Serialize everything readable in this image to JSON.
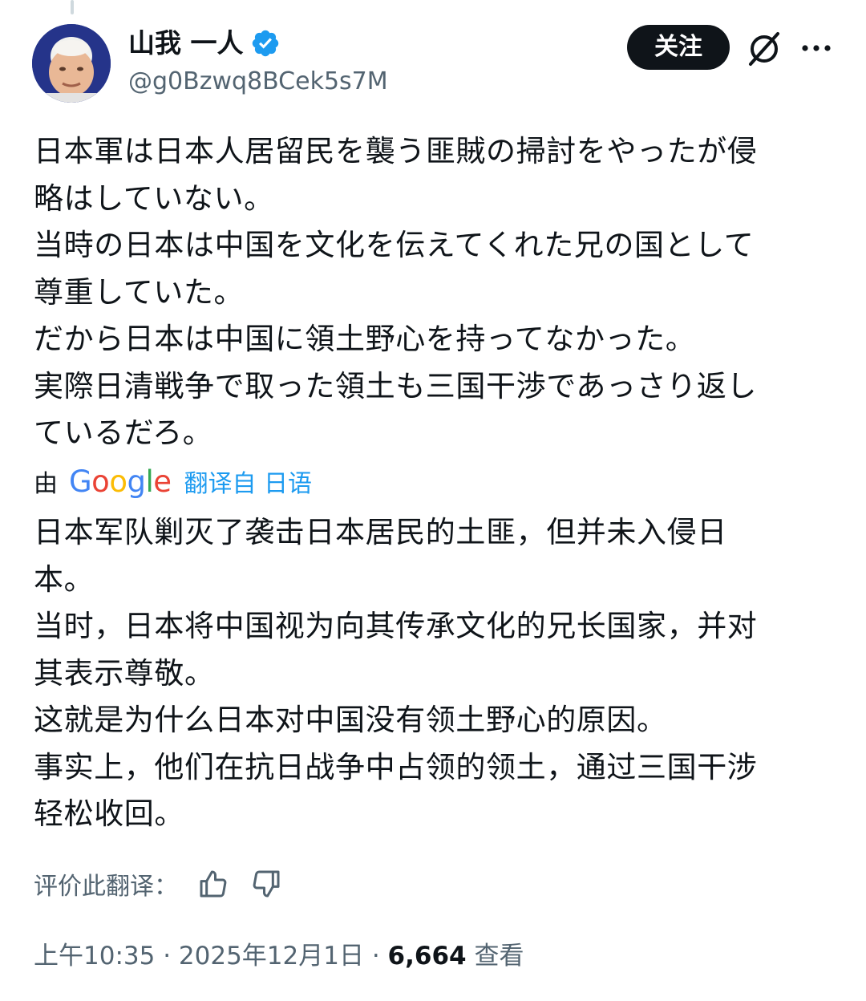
{
  "author": {
    "display_name": "山我 一人",
    "handle": "@g0Bzwq8BCek5s7M",
    "verified": true
  },
  "actions": {
    "follow_label": "关注",
    "grok_icon": "grok-icon",
    "more_icon": "more-icon"
  },
  "tweet": {
    "lines": [
      "日本軍は日本人居留民を襲う匪賊の掃討をやったが侵",
      "略はしていない。",
      "当時の日本は中国を文化を伝えてくれた兄の国として",
      "尊重していた。",
      "だから日本は中国に領土野心を持ってなかった。",
      "実際日清戦争で取った領土も三国干渉であっさり返し",
      "ているだろ。"
    ]
  },
  "translation": {
    "prefix": "由",
    "provider": "Google",
    "link_text": "翻译自 日语",
    "lines": [
      "日本军队剿灭了袭击日本居民的土匪，但并未入侵日",
      "本。",
      "当时，日本将中国视为向其传承文化的兄长国家，并对",
      "其表示尊敬。",
      "这就是为什么日本对中国没有领土野心的原因。",
      "事实上，他们在抗日战争中占领的领土，通过三国干涉",
      "轻松收回。"
    ],
    "rate_label": "评价此翻译：",
    "thumbs_up_icon": "thumbs-up-icon",
    "thumbs_down_icon": "thumbs-down-icon"
  },
  "meta": {
    "time": "上午10:35",
    "separator": " · ",
    "date": "2025年12月1日",
    "views_count": "6,664",
    "views_label": "查看"
  },
  "colors": {
    "text": "#0f1419",
    "secondary": "#536471",
    "link": "#1d9bf0",
    "verified": "#1d9bf0",
    "button_bg": "#0f1419"
  }
}
